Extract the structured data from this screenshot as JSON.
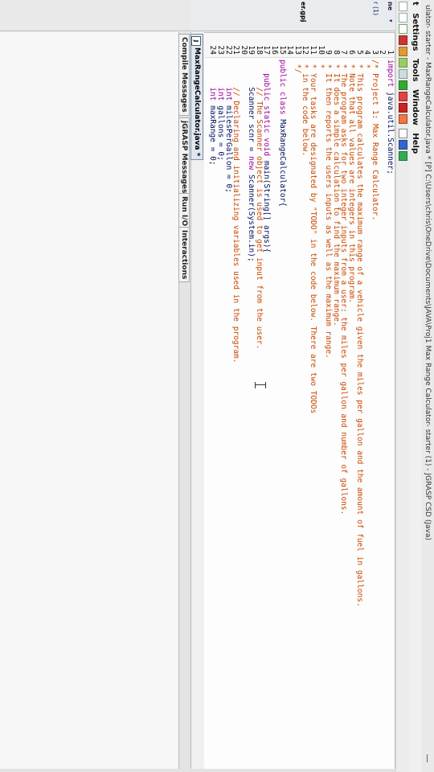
{
  "window": {
    "title": "ulator- starter - MaxRangeCalculator.java * [P] C:\\Users\\chris\\OneDrive\\Documents\\JAVA\\Proj1 Max Range Calculator- starter (1) - JGRASP CSD (Java)"
  },
  "menu": [
    "t",
    "Settings",
    "Tools",
    "Window",
    "Help"
  ],
  "left_panel": {
    "label_top": "ne",
    "label_item": "r (1)",
    "label_file": "er.gpj"
  },
  "code_lines": [
    {
      "n": "1",
      "parts": [
        [
          "kw",
          "import"
        ],
        [
          "tx",
          " java.util.Scanner;"
        ]
      ]
    },
    {
      "n": "2",
      "parts": []
    },
    {
      "n": "3",
      "parts": [
        [
          "cm",
          "/* Project 1: Max Range Calculator."
        ]
      ]
    },
    {
      "n": "4",
      "parts": [
        [
          "cm",
          " *"
        ]
      ]
    },
    {
      "n": "5",
      "parts": [
        [
          "cm",
          " * This program calculates the maximum range of a vehicle given the miles per gallon and the amount of fuel in gallons."
        ]
      ]
    },
    {
      "n": "6",
      "parts": [
        [
          "cm",
          " * Note that all values are integers in this program."
        ]
      ]
    },
    {
      "n": "7",
      "parts": [
        [
          "cm",
          " * The program asks for two integer inputs from a user: the miles per gallon and number of gallons."
        ]
      ]
    },
    {
      "n": "8",
      "parts": [
        [
          "cm",
          " * It does a simple calculation to find the maximum range."
        ]
      ]
    },
    {
      "n": "9",
      "parts": [
        [
          "cm",
          " * It then reports the users inputs as well as the maximum range."
        ]
      ]
    },
    {
      "n": "10",
      "parts": [
        [
          "cm",
          " *"
        ]
      ]
    },
    {
      "n": "11",
      "parts": [
        [
          "cm",
          " * Your tasks are designated by \"TODO\" in the code below. There are two TODOs"
        ]
      ]
    },
    {
      "n": "12",
      "parts": [
        [
          "cm",
          " * in the code below."
        ]
      ]
    },
    {
      "n": "13",
      "parts": [
        [
          "cm",
          " */"
        ]
      ]
    },
    {
      "n": "14",
      "parts": []
    },
    {
      "n": "15",
      "parts": [
        [
          "kw",
          "public class"
        ],
        [
          "tx",
          " MaxRangeCalculator{"
        ]
      ]
    },
    {
      "n": "16",
      "parts": []
    },
    {
      "n": "17",
      "parts": [
        [
          "tx",
          "   "
        ],
        [
          "kw",
          "public static void"
        ],
        [
          "tx",
          " main(String[] args){"
        ]
      ]
    },
    {
      "n": "18",
      "parts": [
        [
          "cm",
          "      // The Scanner object is used to get input from the user."
        ]
      ]
    },
    {
      "n": "19",
      "parts": [
        [
          "tx",
          "      Scanner scnr = "
        ],
        [
          "kw",
          "new"
        ],
        [
          "tx",
          " Scanner(System.in);"
        ]
      ]
    },
    {
      "n": "20",
      "parts": []
    },
    {
      "n": "21",
      "parts": [
        [
          "cm",
          "      // Declaring and initializing variables used in the program."
        ]
      ]
    },
    {
      "n": "22",
      "parts": [
        [
          "tx",
          "      "
        ],
        [
          "kw",
          "int"
        ],
        [
          "tx",
          " milesPerGallon = 0;"
        ]
      ]
    },
    {
      "n": "23",
      "parts": [
        [
          "tx",
          "      "
        ],
        [
          "kw",
          "int"
        ],
        [
          "tx",
          " gallons = 0;"
        ]
      ]
    },
    {
      "n": "24",
      "parts": [
        [
          "tx",
          "      "
        ],
        [
          "kw",
          "int"
        ],
        [
          "tx",
          " maxRange = 0;"
        ]
      ]
    }
  ],
  "editor_tab": {
    "label": "MaxRangeCalculator.java *"
  },
  "bottom_tabs": [
    "Compile Messages",
    "jGRASP Messages",
    "Run I/O",
    "Interactions"
  ]
}
